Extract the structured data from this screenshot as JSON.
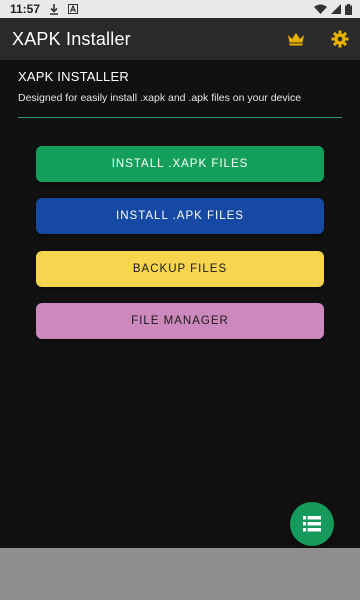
{
  "status_bar": {
    "time": "11:57",
    "icons": [
      "download-icon",
      "a-notification-icon",
      "wifi-icon",
      "signal-icon",
      "battery-icon"
    ]
  },
  "app_bar": {
    "title": "XAPK Installer",
    "icons": [
      "crown-icon",
      "gear-icon"
    ],
    "accent_color": "#e8b100"
  },
  "header": {
    "title": "XAPK INSTALLER",
    "subtitle": "Designed for easily install .xapk and .apk files on your device",
    "divider_color": "#2b9a70"
  },
  "buttons": [
    {
      "label": "INSTALL .XAPK FILES",
      "color": "#14a05a"
    },
    {
      "label": "INSTALL .APK FILES",
      "color": "#1549a3"
    },
    {
      "label": "BACKUP FILES",
      "color": "#f8d54e"
    },
    {
      "label": "FILE MANAGER",
      "color": "#cd88be"
    }
  ],
  "fab": {
    "icon": "list-icon",
    "color": "#159a5b"
  }
}
